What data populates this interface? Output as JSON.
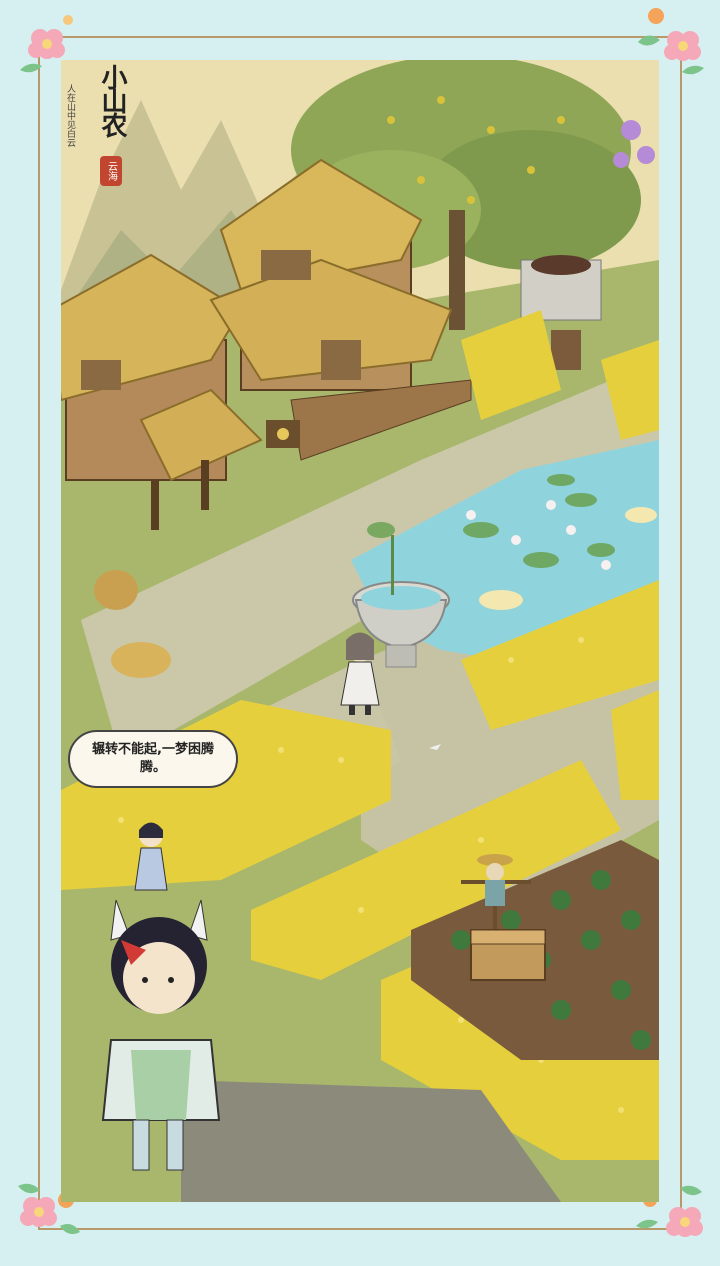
{
  "game": {
    "logo_title": "小山农",
    "logo_subtitle": "人在山中见白云",
    "logo_seal": "云海"
  },
  "npc_dialogue": "辗转不能起,一梦困腾腾。",
  "colors": {
    "frame_bg": "#d6eff0",
    "frame_line": "#b89a6a",
    "pond": "#8fd3dc",
    "grass": "#a8b86a",
    "path": "#c9c6a8",
    "flower": "#f2d23a",
    "thatch": "#d6b45a"
  }
}
